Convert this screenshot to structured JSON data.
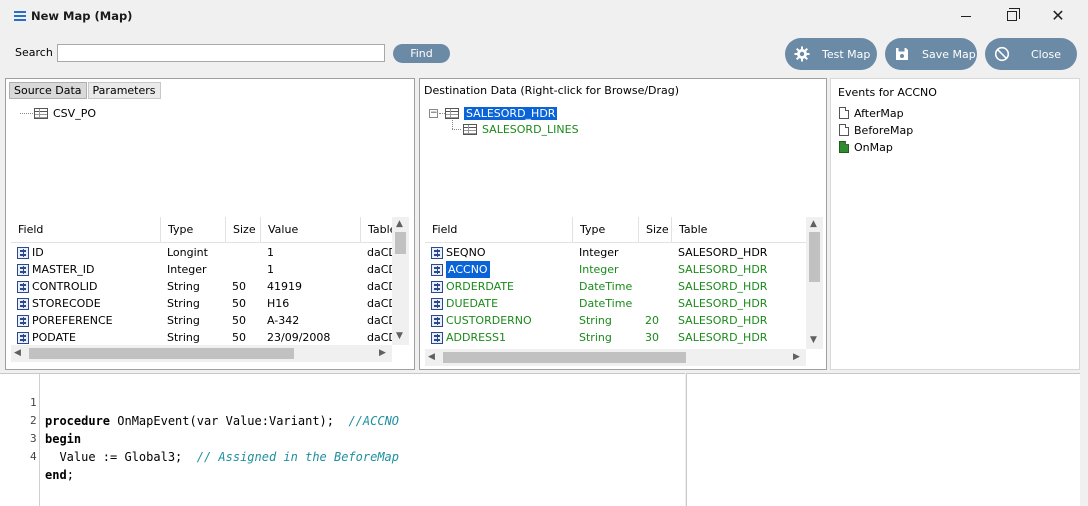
{
  "window": {
    "title": "New Map (Map)"
  },
  "toolbar": {
    "search_label": "Search",
    "search_value": "",
    "find_label": "Find",
    "test_map_label": "Test Map",
    "save_map_label": "Save Map",
    "close_label": "Close"
  },
  "source": {
    "tabs": [
      "Source Data",
      "Parameters"
    ],
    "tree": [
      "CSV_PO"
    ],
    "columns": [
      "Field",
      "Type",
      "Size",
      "Value",
      "Table"
    ],
    "rows": [
      {
        "field": "ID",
        "type": "Longint",
        "size": "",
        "value": "1",
        "table": "daCD"
      },
      {
        "field": "MASTER_ID",
        "type": "Integer",
        "size": "",
        "value": "1",
        "table": "daCD"
      },
      {
        "field": "CONTROLID",
        "type": "String",
        "size": "50",
        "value": "41919",
        "table": "daCD"
      },
      {
        "field": "STORECODE",
        "type": "String",
        "size": "50",
        "value": "H16",
        "table": "daCD"
      },
      {
        "field": "POREFERENCE",
        "type": "String",
        "size": "50",
        "value": "A-342",
        "table": "daCD"
      },
      {
        "field": "PODATE",
        "type": "String",
        "size": "50",
        "value": "23/09/2008",
        "table": "daCD"
      }
    ]
  },
  "destination": {
    "header": "Destination Data   (Right-click for Browse/Drag)",
    "tree": [
      "SALESORD_HDR",
      "SALESORD_LINES"
    ],
    "columns": [
      "Field",
      "Type",
      "Size",
      "Table"
    ],
    "rows": [
      {
        "field": "SEQNO",
        "type": "Integer",
        "size": "",
        "table": "SALESORD_HDR"
      },
      {
        "field": "ACCNO",
        "type": "Integer",
        "size": "",
        "table": "SALESORD_HDR"
      },
      {
        "field": "ORDERDATE",
        "type": "DateTime",
        "size": "",
        "table": "SALESORD_HDR"
      },
      {
        "field": "DUEDATE",
        "type": "DateTime",
        "size": "",
        "table": "SALESORD_HDR"
      },
      {
        "field": "CUSTORDERNO",
        "type": "String",
        "size": "20",
        "table": "SALESORD_HDR"
      },
      {
        "field": "ADDRESS1",
        "type": "String",
        "size": "30",
        "table": "SALESORD_HDR"
      }
    ]
  },
  "events": {
    "title": "Events for ACCNO",
    "items": [
      "AfterMap",
      "BeforeMap",
      "OnMap"
    ]
  },
  "editor": {
    "lines": [
      {
        "num": "1",
        "kw": "procedure",
        "code": " OnMapEvent(var Value:Variant);  ",
        "comment": "//ACCNO"
      },
      {
        "num": "2",
        "kw": "begin",
        "code": "",
        "comment": ""
      },
      {
        "num": "3",
        "kw": "",
        "code": "  Value := Global3;  ",
        "comment": "// Assigned in the BeforeMap"
      },
      {
        "num": "4",
        "kw": "end",
        "code": ";",
        "comment": ""
      }
    ]
  },
  "colors": {
    "accent": "#6b8aa6",
    "selection": "#0a64d8",
    "mapped_text": "#1a8a1a"
  }
}
